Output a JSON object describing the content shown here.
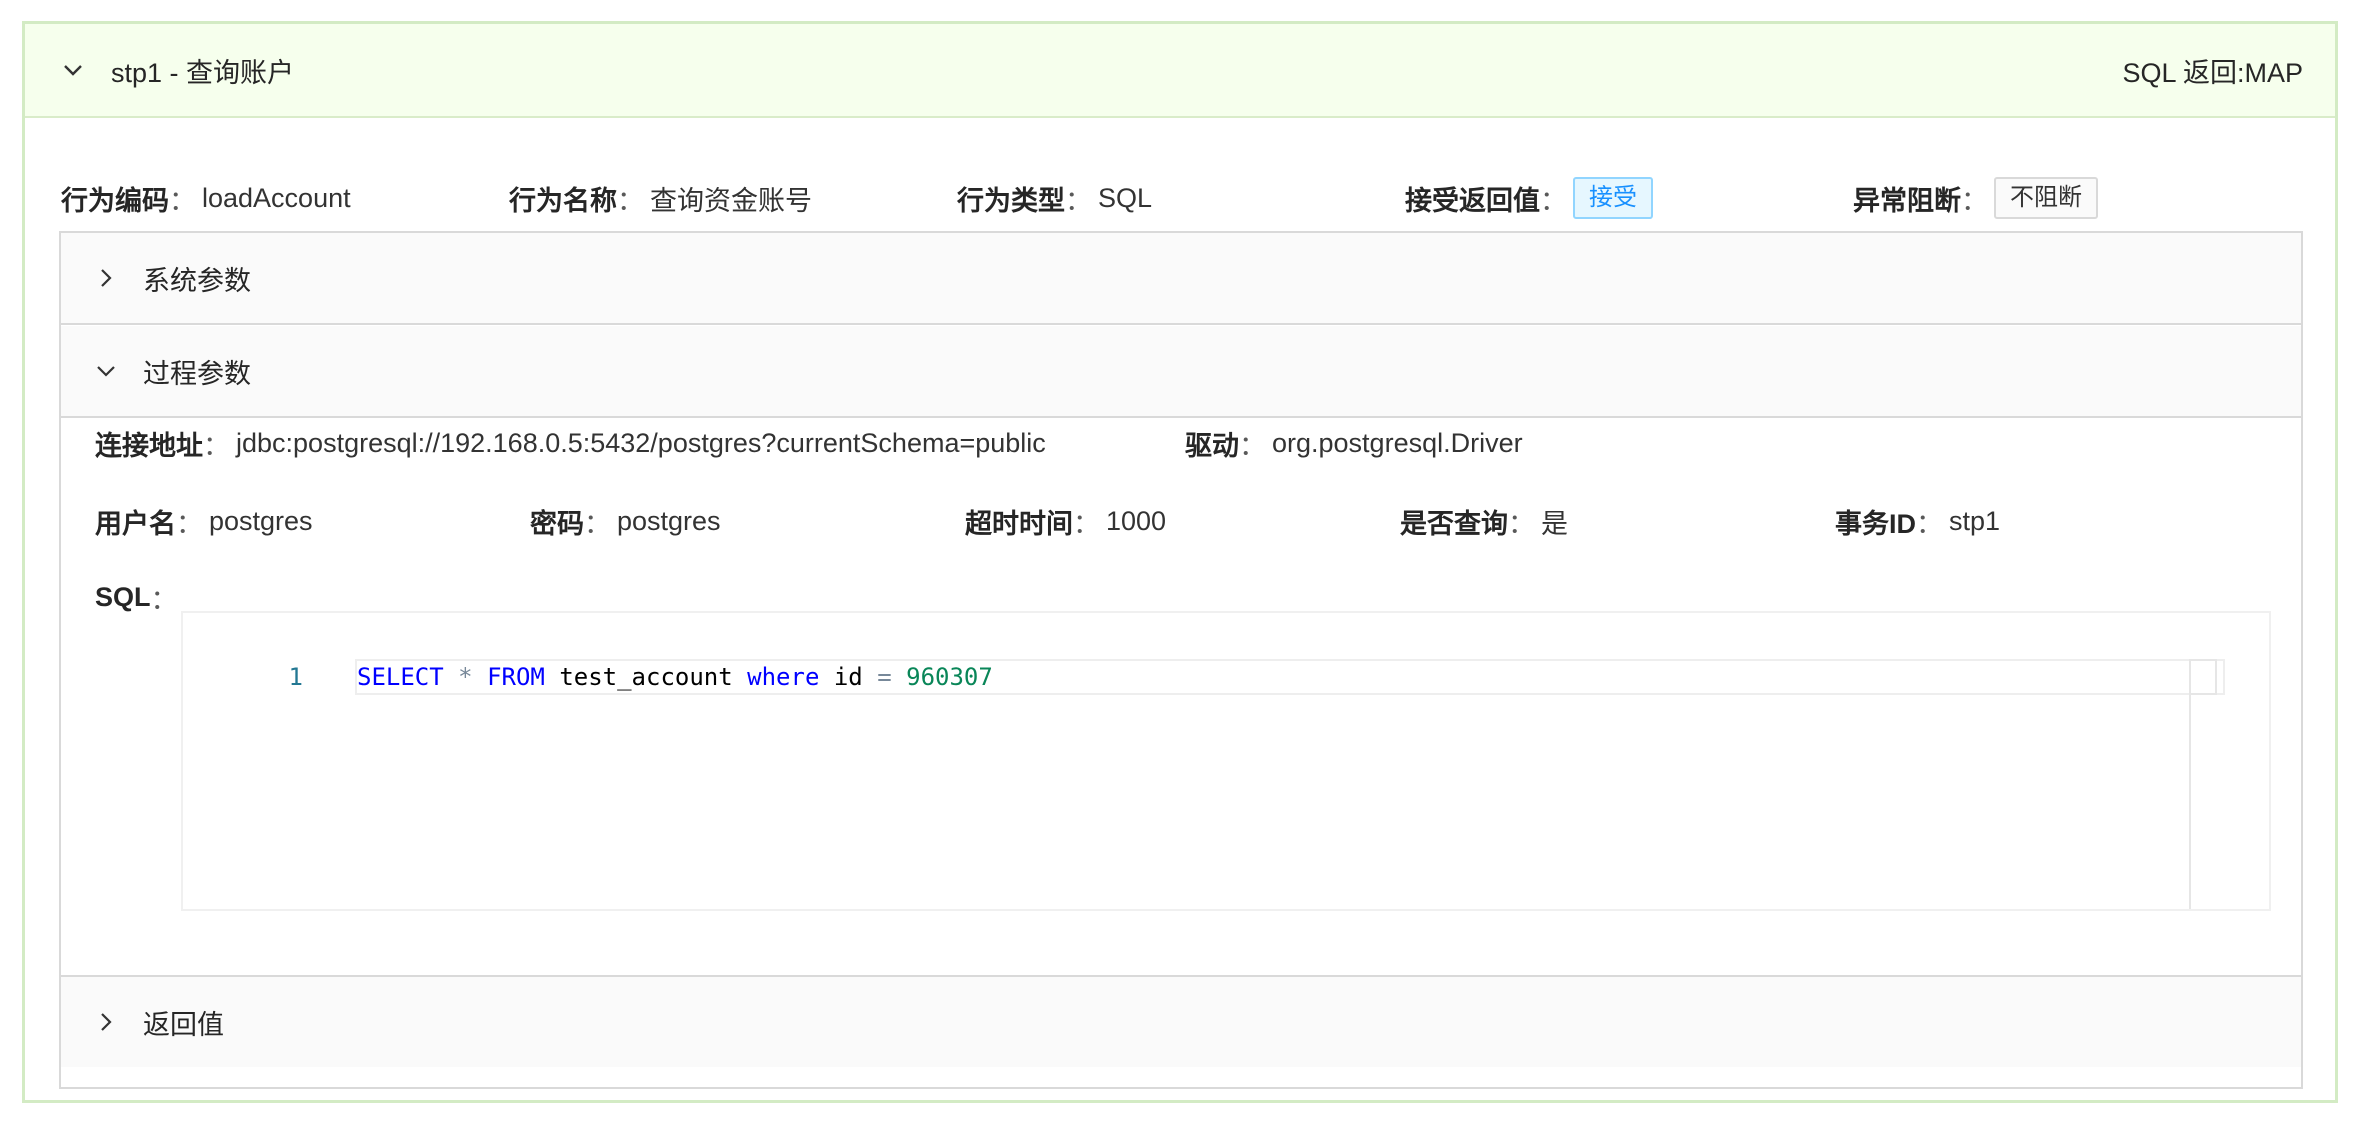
{
  "header": {
    "title": "stp1 - 查询账户",
    "extra": "SQL 返回:MAP"
  },
  "info": {
    "code_label": "行为编码",
    "code_value": "loadAccount",
    "name_label": "行为名称",
    "name_value": "查询资金账号",
    "type_label": "行为类型",
    "type_value": "SQL",
    "accept_label": "接受返回值",
    "accept_tag": "接受",
    "block_label": "异常阻断",
    "block_tag": "不阻断",
    "colon": "："
  },
  "panels": {
    "system_params": "系统参数",
    "process_params": "过程参数",
    "return_value": "返回值"
  },
  "process": {
    "url_label": "连接地址",
    "url_value": "jdbc:postgresql://192.168.0.5:5432/postgres?currentSchema=public",
    "driver_label": "驱动",
    "driver_value": "org.postgresql.Driver",
    "user_label": "用户名",
    "user_value": "postgres",
    "password_label": "密码",
    "password_value": "postgres",
    "timeout_label": "超时时间",
    "timeout_value": "1000",
    "is_query_label": "是否查询",
    "is_query_value": "是",
    "tx_label": "事务ID",
    "tx_value": "stp1",
    "sql_label": "SQL"
  },
  "editor": {
    "line_number": "1",
    "tokens": {
      "t1": "SELECT",
      "t2": "*",
      "t3": "FROM",
      "t4": "test_account",
      "t5": "where",
      "t6": "id",
      "t7": "=",
      "t8": "960307"
    }
  },
  "colors": {
    "header_bg": "#f6ffed",
    "header_border": "#d3ebc4",
    "tag_blue": "#1890ff",
    "keyword": "#0000ff",
    "number": "#098658"
  }
}
